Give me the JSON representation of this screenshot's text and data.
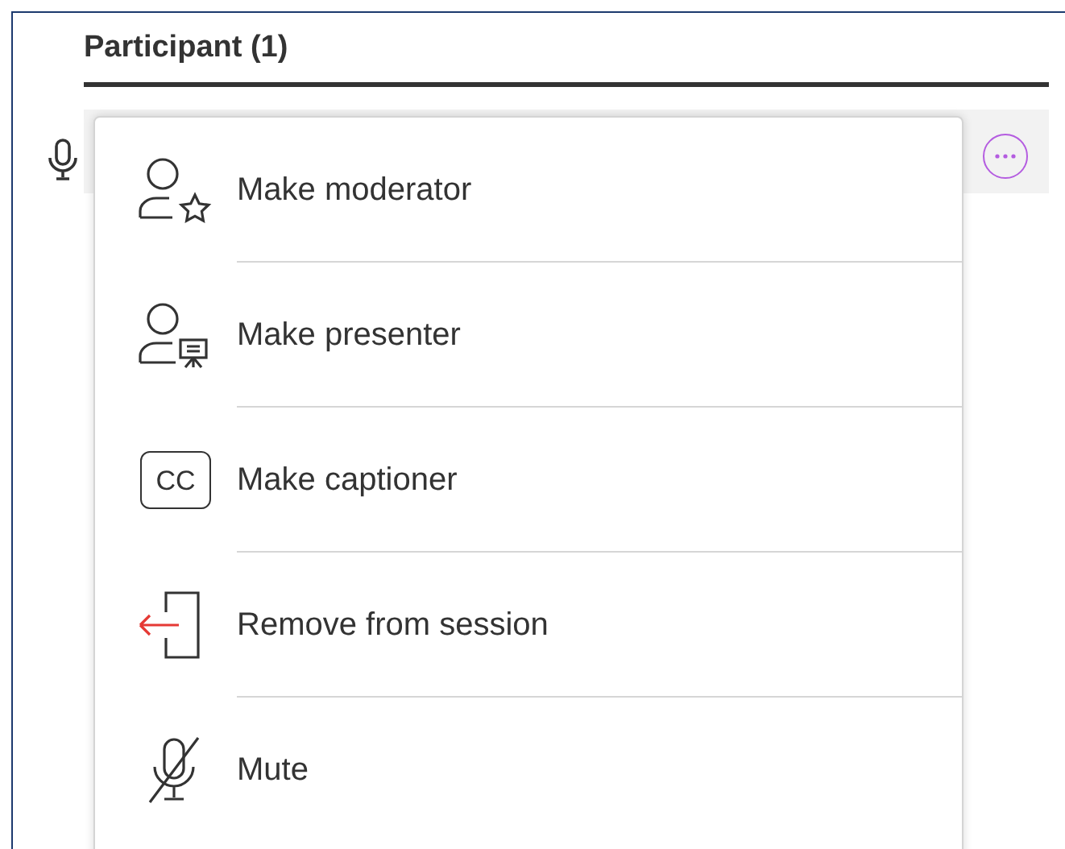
{
  "panel": {
    "title": "Participant (1)"
  },
  "menu": {
    "items": [
      {
        "kind": "moderator",
        "label": "Make moderator"
      },
      {
        "kind": "presenter",
        "label": "Make presenter"
      },
      {
        "kind": "captioner",
        "label": "Make captioner",
        "icon_text": "CC"
      },
      {
        "kind": "remove",
        "label": "Remove from session"
      },
      {
        "kind": "mute",
        "label": "Mute"
      }
    ]
  }
}
